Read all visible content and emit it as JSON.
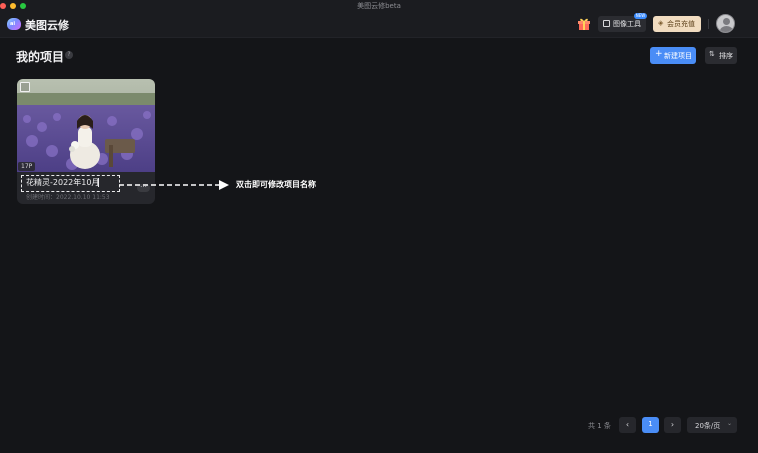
{
  "window": {
    "title": "美图云修beta"
  },
  "header": {
    "logo_text": "ai",
    "app_name": "美图云修",
    "image_tools_label": "图像工具",
    "image_tools_badge": "NEW",
    "vip_label": "会员充值",
    "icons": {
      "gift": "gift-icon",
      "image_tools": "image-tool-icon",
      "vip": "diamond-icon",
      "avatar": "user-avatar"
    }
  },
  "page": {
    "title": "我的项目",
    "help_mark": "?",
    "new_project_label": "新建项目",
    "sort_label": "排序"
  },
  "project": {
    "name": "花精灵-2022年10月",
    "photo_count": "17P",
    "created": "创建时间：2022.10.10 11:53",
    "more": "···"
  },
  "hint": {
    "text": "双击即可修改项目名称"
  },
  "pagination": {
    "total": "共 1 条",
    "prev": "‹",
    "current_page": "1",
    "next": "›",
    "page_size": "20条/页",
    "page_size_chevron": "⌄"
  },
  "colors": {
    "background": "#141518",
    "accent": "#4a8df6",
    "vip": "#f1dcc0"
  }
}
